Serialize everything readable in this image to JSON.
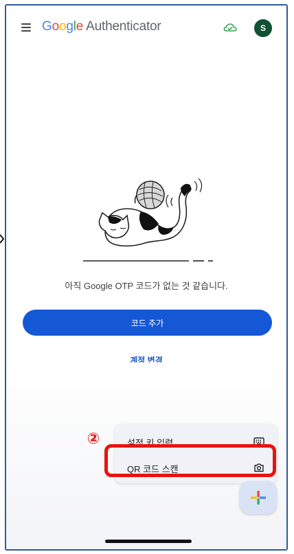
{
  "app": {
    "brand_google": "Google",
    "brand_product": "Authenticator",
    "avatar_initial": "S"
  },
  "empty_state": {
    "message": "아직 Google OTP 코드가 없는 것 같습니다."
  },
  "actions": {
    "add_code_label": "코드 추가",
    "switch_account_label": "계정 변경"
  },
  "add_menu": {
    "items": [
      {
        "label": "설정 키 입력",
        "icon": "keyboard-icon"
      },
      {
        "label": "QR 코드 스캔",
        "icon": "camera-icon"
      }
    ]
  },
  "annotation": {
    "step": "②",
    "highlight_color": "#e8130f"
  },
  "colors": {
    "primary": "#1558d6",
    "avatar_bg": "#0f5132",
    "sync_cloud": "#34a853"
  }
}
